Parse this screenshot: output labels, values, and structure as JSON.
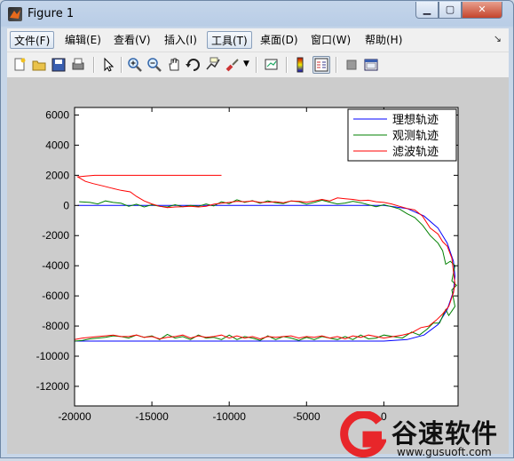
{
  "window": {
    "title": "Figure 1"
  },
  "menu": [
    {
      "label": "文件(F)",
      "name": "menu-file"
    },
    {
      "label": "编辑(E)",
      "name": "menu-edit"
    },
    {
      "label": "查看(V)",
      "name": "menu-view"
    },
    {
      "label": "插入(I)",
      "name": "menu-insert"
    },
    {
      "label": "工具(T)",
      "name": "menu-tools"
    },
    {
      "label": "桌面(D)",
      "name": "menu-desktop"
    },
    {
      "label": "窗口(W)",
      "name": "menu-window"
    },
    {
      "label": "帮助(H)",
      "name": "menu-help"
    }
  ],
  "toolbar": [
    {
      "name": "new-figure-icon"
    },
    {
      "name": "open-file-icon"
    },
    {
      "name": "save-icon"
    },
    {
      "name": "print-icon"
    },
    {
      "name": "edit-plot-arrow-icon"
    },
    {
      "name": "zoom-in-icon"
    },
    {
      "name": "zoom-out-icon"
    },
    {
      "name": "pan-hand-icon"
    },
    {
      "name": "rotate-3d-icon"
    },
    {
      "name": "data-cursor-icon"
    },
    {
      "name": "brush-icon"
    },
    {
      "name": "link-plot-icon"
    },
    {
      "name": "colorbar-icon"
    },
    {
      "name": "legend-icon"
    },
    {
      "name": "hide-plot-tools-icon"
    },
    {
      "name": "show-plot-tools-icon"
    }
  ],
  "colors": {
    "ideal": "#0000ff",
    "observed": "#008000",
    "filtered": "#ff0000"
  },
  "watermark": {
    "brand": "谷速软件",
    "url": "www.gusuoft.com"
  },
  "chart_data": {
    "type": "line",
    "title": "",
    "xlabel": "",
    "ylabel": "",
    "xlim": [
      -20000,
      4800
    ],
    "ylim": [
      -13300,
      6500
    ],
    "x_ticks": [
      -20000,
      -15000,
      -10000,
      -5000,
      0
    ],
    "x_tick_labels": [
      "-20000",
      "-15000",
      "-10000",
      "-5000",
      "0"
    ],
    "y_ticks": [
      6000,
      4000,
      2000,
      0,
      -2000,
      -4000,
      -6000,
      -8000,
      -10000,
      -12000
    ],
    "y_tick_labels": [
      "6000",
      "4000",
      "2000",
      "0",
      "-2000",
      "-4000",
      "-6000",
      "-8000",
      "-10000",
      "-12000"
    ],
    "grid": false,
    "legend_position": "top-right",
    "series": [
      {
        "name": "理想轨迹",
        "color_key": "ideal",
        "x": [
          -19800,
          -16000,
          -12000,
          -8000,
          -4000,
          0,
          1500,
          2600,
          3500,
          4100,
          4500,
          4600,
          4500,
          4100,
          3500,
          2600,
          1500,
          0,
          -4000,
          -8000,
          -12000,
          -16000,
          -20000
        ],
        "y": [
          0,
          0,
          0,
          0,
          0,
          0,
          -200,
          -700,
          -1500,
          -2500,
          -3700,
          -4700,
          -5700,
          -6900,
          -7900,
          -8600,
          -8900,
          -9000,
          -9000,
          -9000,
          -9000,
          -9000,
          -9000
        ]
      },
      {
        "name": "观测轨迹",
        "color_key": "observed",
        "x": [
          -19700,
          -19000,
          -18500,
          -18000,
          -17500,
          -17000,
          -16500,
          -16000,
          -15500,
          -15000,
          -14500,
          -14000,
          -13500,
          -13000,
          -12500,
          -12000,
          -11500,
          -11000,
          -10500,
          -10000,
          -9500,
          -9000,
          -8500,
          -8000,
          -7500,
          -7000,
          -6500,
          -6000,
          -5500,
          -5000,
          -4500,
          -4000,
          -3500,
          -3000,
          -2500,
          -2000,
          -1500,
          -1000,
          -500,
          0,
          500,
          1000,
          1500,
          2000,
          2500,
          3000,
          3500,
          3800,
          4000,
          4300,
          4600,
          4400,
          4700,
          4400,
          4600,
          4200,
          4000,
          3600,
          3200,
          2800,
          2300,
          1800,
          1200,
          600,
          0,
          -500,
          -1000,
          -1500,
          -2000,
          -2500,
          -3000,
          -3500,
          -4000,
          -4500,
          -5000,
          -5500,
          -6000,
          -6500,
          -7000,
          -7500,
          -8000,
          -8500,
          -9000,
          -9500,
          -10000,
          -10500,
          -11000,
          -11500,
          -12000,
          -12500,
          -13000,
          -13500,
          -14000,
          -14500,
          -15000,
          -15500,
          -16000,
          -16500,
          -17000,
          -17500,
          -18000,
          -18500,
          -19000,
          -19500,
          -20000
        ],
        "y": [
          250,
          200,
          100,
          300,
          200,
          150,
          -50,
          80,
          -100,
          50,
          -50,
          -100,
          50,
          -80,
          0,
          -60,
          100,
          -30,
          250,
          120,
          380,
          200,
          320,
          150,
          300,
          180,
          120,
          300,
          250,
          80,
          200,
          350,
          220,
          100,
          160,
          280,
          180,
          50,
          -80,
          50,
          -80,
          -230,
          -550,
          -800,
          -1300,
          -2000,
          -2500,
          -3000,
          -3900,
          -3700,
          -4000,
          -5000,
          -5300,
          -5600,
          -6700,
          -7300,
          -6900,
          -7800,
          -7800,
          -8200,
          -8600,
          -8400,
          -8800,
          -8700,
          -8600,
          -8800,
          -8850,
          -8600,
          -8900,
          -8700,
          -8900,
          -8800,
          -8700,
          -8900,
          -8750,
          -8950,
          -8800,
          -8700,
          -8900,
          -8650,
          -8950,
          -8800,
          -8700,
          -8900,
          -8600,
          -8900,
          -8750,
          -8800,
          -8600,
          -8900,
          -8700,
          -8800,
          -8550,
          -8900,
          -8650,
          -8750,
          -8600,
          -8800,
          -8700,
          -8650,
          -8750,
          -8800,
          -8850,
          -8950,
          -9000
        ]
      },
      {
        "name": "滤波轨迹",
        "color_key": "filtered",
        "x": [
          -10500,
          -12000,
          -14000,
          -15500,
          -16500,
          -17300,
          -18000,
          -18700,
          -19300,
          -19800,
          -19300,
          -18800,
          -18200,
          -17600,
          -17000,
          -16400,
          -16000,
          -15500,
          -15000,
          -14500,
          -14000,
          -13500,
          -13000,
          -12500,
          -12000,
          -11500,
          -11000,
          -10500,
          -10000,
          -9500,
          -9000,
          -8500,
          -8000,
          -7500,
          -7000,
          -6500,
          -6000,
          -5500,
          -5000,
          -4500,
          -4000,
          -3500,
          -3000,
          -2500,
          -2000,
          -1500,
          -1000,
          -500,
          0,
          500,
          1000,
          1500,
          2000,
          2500,
          3000,
          3500,
          3800,
          4100,
          4400,
          4500,
          4600,
          4500,
          4200,
          3800,
          3400,
          2900,
          2400,
          1800,
          1200,
          600,
          0,
          -500,
          -1000,
          -1500,
          -2000,
          -2500,
          -3000,
          -3500,
          -4000,
          -4500,
          -5000,
          -5500,
          -6000,
          -6500,
          -7000,
          -7500,
          -8000,
          -8500,
          -9000,
          -9500,
          -10000,
          -10500,
          -11000,
          -11500,
          -12000,
          -12500,
          -13000,
          -13500,
          -14000,
          -14500,
          -15000,
          -15500,
          -16000,
          -16500,
          -17000,
          -17500,
          -18000,
          -18500,
          -19000,
          -19500,
          -20000
        ],
        "y": [
          2000,
          2000,
          2000,
          2000,
          2000,
          2000,
          2000,
          2000,
          1950,
          1900,
          1600,
          1450,
          1300,
          1150,
          1000,
          900,
          600,
          300,
          100,
          -50,
          -150,
          -100,
          -80,
          -50,
          -100,
          -60,
          80,
          150,
          200,
          280,
          250,
          300,
          200,
          220,
          250,
          180,
          300,
          280,
          220,
          300,
          400,
          300,
          500,
          450,
          400,
          320,
          350,
          250,
          200,
          100,
          -50,
          -200,
          -300,
          -700,
          -1500,
          -1900,
          -2400,
          -2700,
          -3500,
          -4400,
          -5200,
          -5800,
          -6700,
          -7200,
          -7600,
          -8000,
          -8100,
          -8450,
          -8600,
          -8700,
          -8800,
          -8700,
          -8600,
          -8750,
          -8650,
          -8850,
          -8700,
          -8800,
          -8650,
          -8750,
          -8700,
          -8800,
          -8650,
          -8700,
          -8750,
          -8700,
          -8850,
          -8700,
          -8800,
          -8650,
          -8800,
          -8600,
          -8700,
          -8750,
          -8650,
          -8800,
          -8600,
          -8700,
          -8750,
          -8850,
          -8700,
          -8750,
          -8600,
          -8700,
          -8700,
          -8600,
          -8650,
          -8700,
          -8750,
          -8800,
          -8900
        ]
      }
    ]
  }
}
